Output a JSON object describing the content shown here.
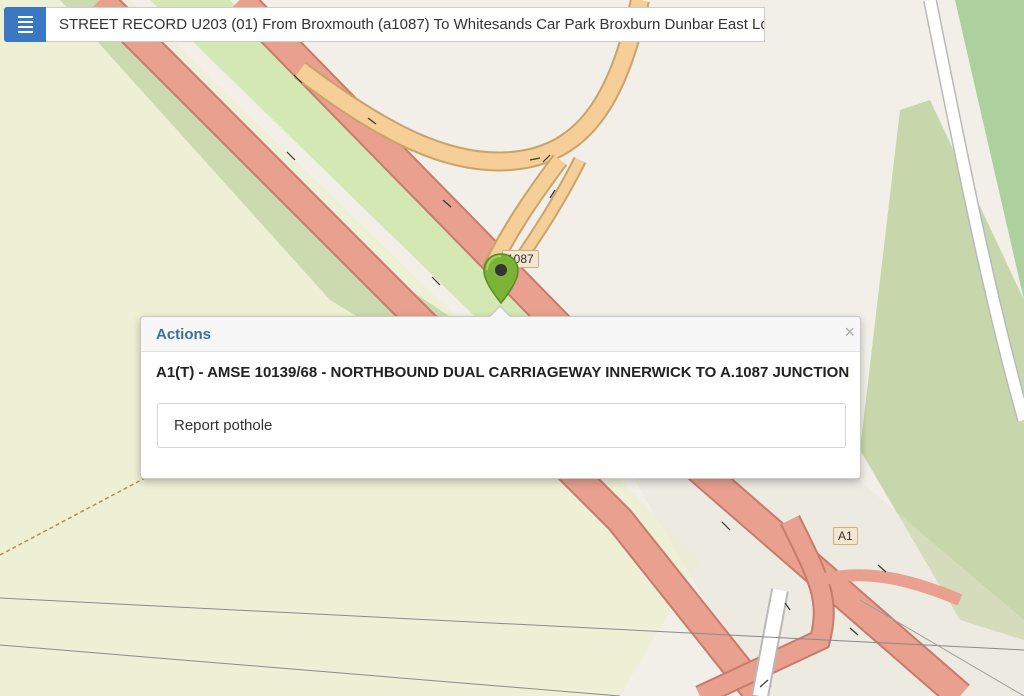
{
  "header": {
    "menu_icon": "hamburger-menu-icon",
    "street_record": "STREET RECORD U203 (01) From Broxmouth (a1087) To Whitesands Car Park Broxburn Dunbar East Lo"
  },
  "map": {
    "road_labels": [
      "1087",
      "A1"
    ],
    "marker_icon": "map-pin-icon",
    "colors": {
      "background": "#f2efe9",
      "trunk_road": "#e9a08e",
      "trunk_casing": "#c77b6a",
      "secondary_road": "#f6cf98",
      "verge": "#d4e8b4",
      "woodland": "#add19e",
      "scrub": "#c8d7ab",
      "field": "#eef0d5"
    }
  },
  "popup": {
    "title": "Actions",
    "close_label": "×",
    "heading": "A1(T) - AMSE 10139/68 - NORTHBOUND DUAL CARRIAGEWAY INNERWICK TO A.1087 JUNCTION",
    "actions": [
      {
        "label": "Report pothole"
      }
    ]
  }
}
